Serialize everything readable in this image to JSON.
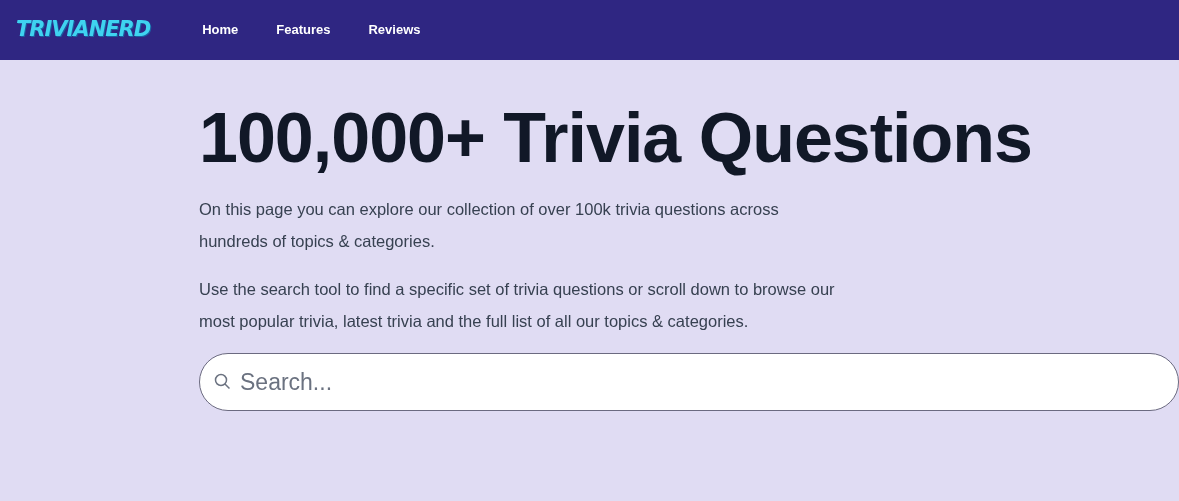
{
  "navbar": {
    "logo": "TRIVIANERD",
    "links": [
      {
        "label": "Home"
      },
      {
        "label": "Features"
      },
      {
        "label": "Reviews"
      }
    ]
  },
  "hero": {
    "title": "100,000+ Trivia Questions",
    "paragraphs": [
      "On this page you can explore our collection of over 100k trivia questions across hundreds of topics & categories.",
      "Use the search tool to find a specific set of trivia questions or scroll down to browse our most popular trivia, latest trivia and the full list of all our topics & categories."
    ],
    "search": {
      "placeholder": "Search..."
    }
  }
}
